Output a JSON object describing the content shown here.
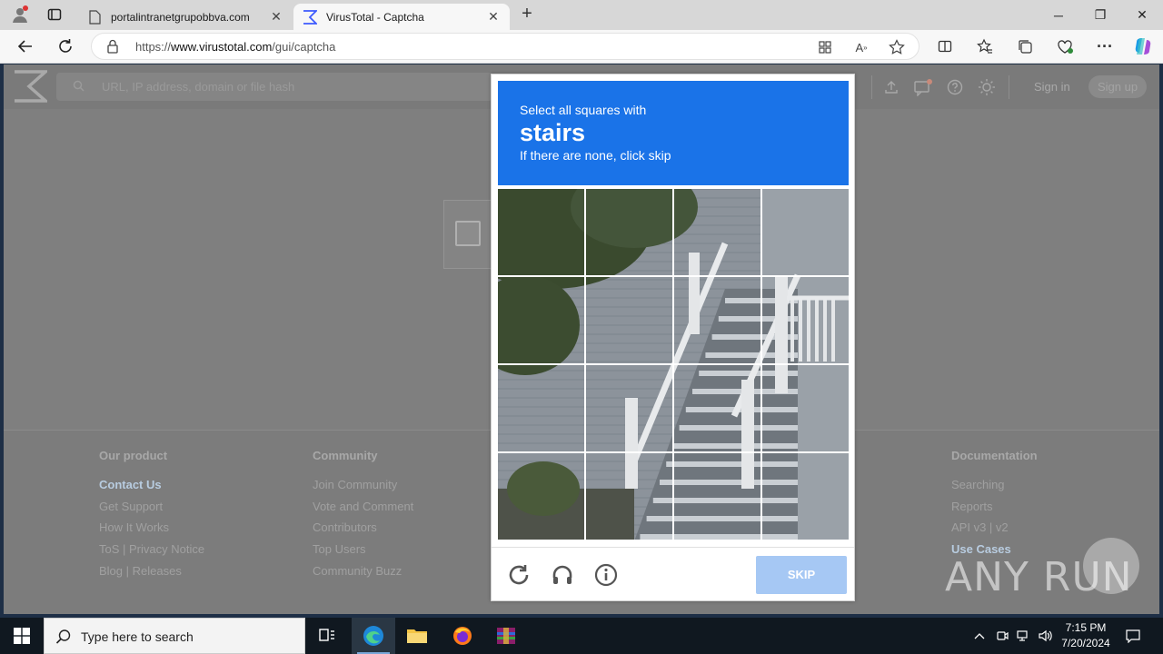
{
  "browser": {
    "tabs": [
      {
        "title": "portalintranetgrupobbva.com",
        "active": false
      },
      {
        "title": "VirusTotal - Captcha",
        "active": true
      }
    ],
    "url_prefix": "https://",
    "url_domain": "www.virustotal.com",
    "url_path": "/gui/captcha",
    "window_controls": {
      "minimize": "─",
      "restore": "❐",
      "close": "✕"
    },
    "new_tab": "+"
  },
  "vt": {
    "search_placeholder": "URL, IP address, domain or file hash",
    "sign_in": "Sign in",
    "sign_up": "Sign up"
  },
  "footer": {
    "columns": [
      {
        "heading": "Our product",
        "links": [
          "Contact Us",
          "Get Support",
          "How It Works",
          "ToS | Privacy Notice",
          "Blog | Releases"
        ],
        "highlight": [
          0
        ]
      },
      {
        "heading": "Community",
        "links": [
          "Join Community",
          "Vote and Comment",
          "Contributors",
          "Top Users",
          "Community Buzz"
        ],
        "highlight": []
      },
      {
        "heading": "Documentation",
        "links": [
          "Searching",
          "Reports",
          "API v3 | v2",
          "Use Cases"
        ],
        "highlight": [
          3
        ]
      }
    ]
  },
  "captcha": {
    "line1": "Select all squares with",
    "target": "stairs",
    "line3": "If there are none, click skip",
    "skip_label": "SKIP",
    "rows": 4,
    "cols": 4,
    "accent": "#1a73e8"
  },
  "watermark": "ANY RUN",
  "taskbar": {
    "search_text": "Type here to search",
    "time": "7:15 PM",
    "date": "7/20/2024"
  }
}
